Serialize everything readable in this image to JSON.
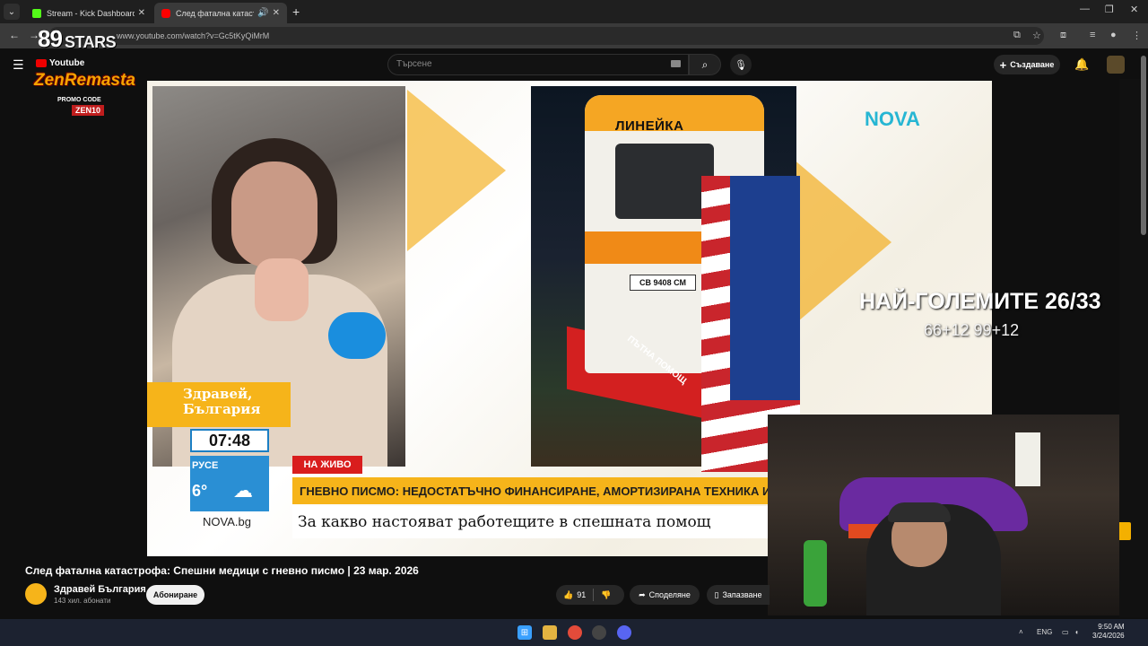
{
  "browser": {
    "tabs": [
      {
        "title": "Stream - Kick Dashboard",
        "favicon_color": "#53fc18"
      },
      {
        "title": "След фатална катастрофа:",
        "favicon_color": "#ff0000",
        "active": true
      }
    ],
    "new_tab": "+",
    "url": "www.youtube.com/watch?v=Gc5tKyQiMrM"
  },
  "overlay_logo": {
    "number": "89",
    "stars": "STARS",
    "youtube": "Youtube",
    "name": "ZenRemasta",
    "promo": "PROMO CODE",
    "code": "ZEN10"
  },
  "youtube_header": {
    "search_placeholder": "Търсене",
    "create_label": "Създаване"
  },
  "video_frame": {
    "ambulance_text": "ЛИНЕЙКА",
    "plate": "СВ 9408 СМ",
    "truck_text": "ПЪТНА ПОМОЩ",
    "nova_logo": "NOVA",
    "show_name_line1": "Здравей,",
    "show_name_line2": "България",
    "clock": "07:48",
    "weather_city": "РУСЕ",
    "weather_temp": "6°",
    "site": "NOVA.bg",
    "live_label": "НА ЖИВО",
    "ticker_headline": "ГНЕВНО ПИСМО: НЕДОСТАТЪЧНО ФИНАНСИРАНЕ, АМОРТИЗИРАНА ТЕХНИКА И",
    "ticker_sub": "За какво настояват работещите в спешната помощ"
  },
  "stream_overlay": {
    "score": "НАЙ-ГОЛЕМИТЕ 26/33",
    "score_sub": "66+12 99+12"
  },
  "video_info": {
    "title": "След фатална катастрофа: Спешни медици с гневно писмо | 23 мар. 2026",
    "channel": "Здравей България",
    "subscribers": "143 хил. абонати",
    "subscribe_label": "Абониране",
    "likes": "91",
    "share_label": "Споделяне",
    "save_label": "Запазване"
  },
  "taskbar": {
    "lang": "ENG",
    "time": "9:50 AM",
    "date": "3/24/2026"
  }
}
